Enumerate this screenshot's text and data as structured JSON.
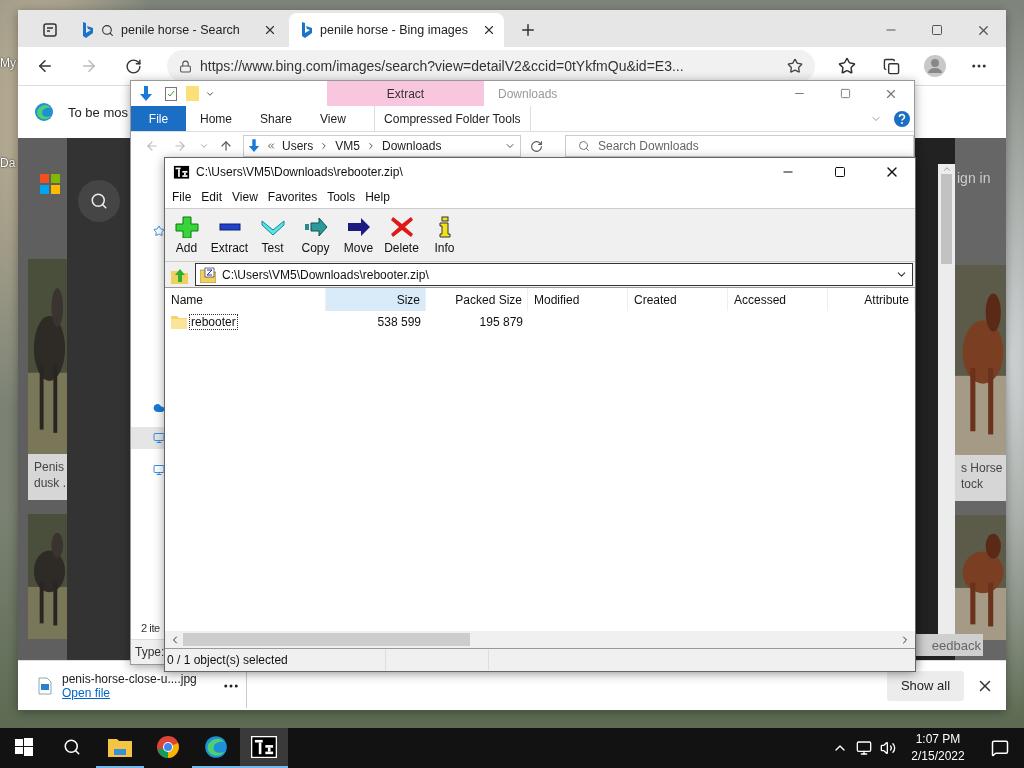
{
  "desktop": {
    "icon_labels": [
      "My",
      "Da"
    ]
  },
  "browser": {
    "tabs": [
      {
        "title": "penile horse - Search",
        "selected": false
      },
      {
        "title": "penile horse - Bing images",
        "selected": true
      }
    ],
    "url": "https://www.bing.com/images/search?view=detailV2&ccid=0tYkfmQu&id=E3...",
    "infobar": "To be mos",
    "page": {
      "sign_in": "ign in",
      "feedback": "eedback",
      "left_caption": [
        "Penis",
        "dusk ."
      ],
      "right_caption": [
        "s Horse",
        "tock"
      ]
    },
    "download": {
      "file": "penis-horse-close-u....jpg",
      "action": "Open file",
      "show_all": "Show all"
    }
  },
  "explorer": {
    "context_tab": "Extract",
    "title": "Downloads",
    "ribbon_tabs": [
      {
        "label": "File",
        "kind": "file"
      },
      {
        "label": "Home",
        "kind": "tab"
      },
      {
        "label": "Share",
        "kind": "tab"
      },
      {
        "label": "View",
        "kind": "tab"
      },
      {
        "label": "Compressed Folder Tools",
        "kind": "context"
      }
    ],
    "breadcrumb": [
      "Users",
      "VM5",
      "Downloads"
    ],
    "search_placeholder": "Search Downloads",
    "nav": [
      {
        "kind": "star",
        "selected": false
      },
      {
        "kind": "cloud",
        "selected": false
      },
      {
        "kind": "pc",
        "selected": true
      },
      {
        "kind": "network",
        "selected": false
      }
    ],
    "status": "2 ite",
    "details": "Type:"
  },
  "sevenzip": {
    "title": "C:\\Users\\VM5\\Downloads\\rebooter.zip\\",
    "menu": [
      "File",
      "Edit",
      "View",
      "Favorites",
      "Tools",
      "Help"
    ],
    "tools": [
      {
        "label": "Add",
        "kind": "add"
      },
      {
        "label": "Extract",
        "kind": "extract"
      },
      {
        "label": "Test",
        "kind": "test"
      },
      {
        "label": "Copy",
        "kind": "copy"
      },
      {
        "label": "Move",
        "kind": "move"
      },
      {
        "label": "Delete",
        "kind": "delete"
      },
      {
        "label": "Info",
        "kind": "info"
      }
    ],
    "path": "C:\\Users\\VM5\\Downloads\\rebooter.zip\\",
    "columns": [
      {
        "label": "Name",
        "sorted": false
      },
      {
        "label": "Size",
        "sorted": true
      },
      {
        "label": "Packed Size",
        "sorted": false
      },
      {
        "label": "Modified",
        "sorted": false
      },
      {
        "label": "Created",
        "sorted": false
      },
      {
        "label": "Accessed",
        "sorted": false
      },
      {
        "label": "Attribute",
        "sorted": false
      }
    ],
    "rows": [
      {
        "cells": [
          "rebooter",
          "538 599",
          "195 879"
        ],
        "focused": true
      }
    ],
    "status": "0 / 1 object(s) selected"
  },
  "taskbar": {
    "apps": [
      {
        "kind": "start",
        "running": false,
        "selected": false
      },
      {
        "kind": "search",
        "running": false,
        "selected": false
      },
      {
        "kind": "explorer",
        "running": true,
        "selected": false
      },
      {
        "kind": "chrome",
        "running": false,
        "selected": false
      },
      {
        "kind": "edge",
        "running": true,
        "selected": false
      },
      {
        "kind": "sevenzip",
        "running": true,
        "selected": true
      }
    ],
    "time": "1:07 PM",
    "date": "2/15/2022"
  }
}
